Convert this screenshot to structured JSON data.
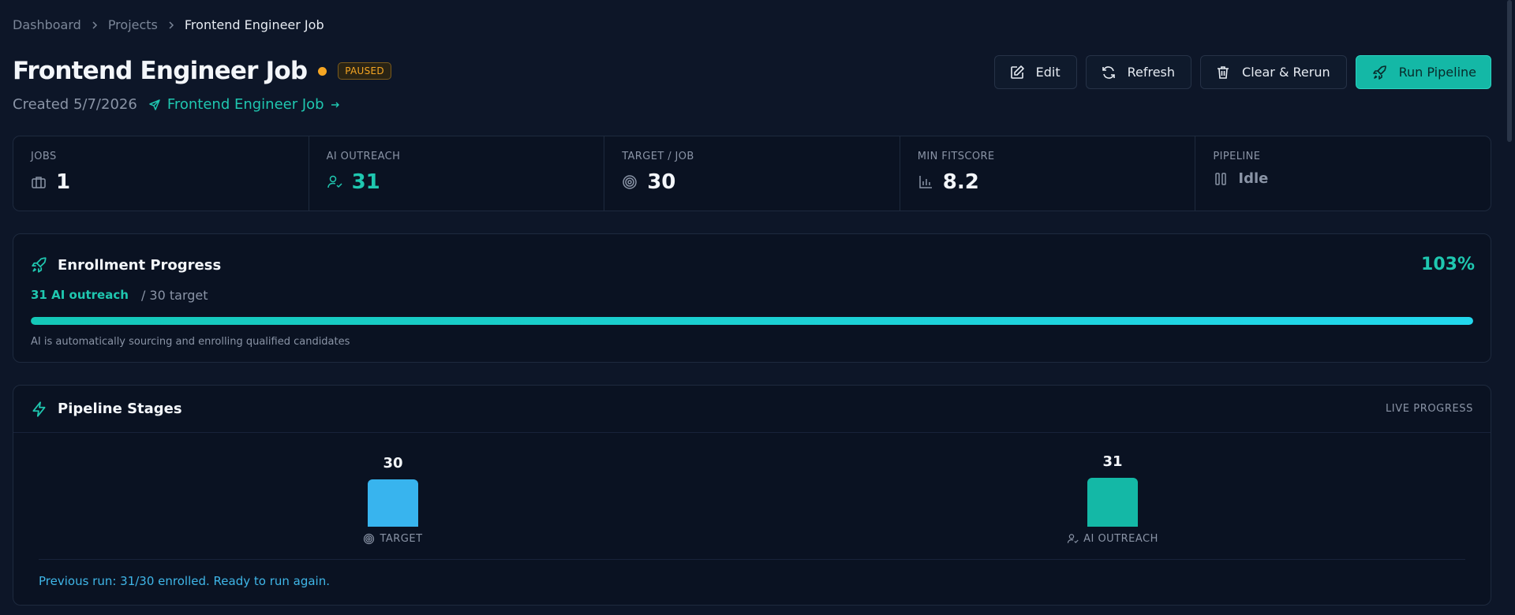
{
  "breadcrumb": [
    "Dashboard",
    "Projects",
    "Frontend Engineer Job"
  ],
  "header": {
    "title": "Frontend Engineer Job",
    "status": "PAUSED",
    "created": "Created 5/7/2026",
    "job_link": "Frontend Engineer Job",
    "actions": {
      "edit": "Edit",
      "refresh": "Refresh",
      "clear_rerun": "Clear & Rerun",
      "run": "Run Pipeline"
    }
  },
  "stats": [
    {
      "label": "JOBS",
      "value": "1",
      "icon": "briefcase-icon"
    },
    {
      "label": "AI OUTREACH",
      "value": "31",
      "icon": "user-check-icon"
    },
    {
      "label": "TARGET / JOB",
      "value": "30",
      "icon": "target-icon"
    },
    {
      "label": "MIN FITSCORE",
      "value": "8.2",
      "icon": "bar-chart-icon"
    },
    {
      "label": "PIPELINE",
      "value": "Idle",
      "icon": "pause-icon"
    }
  ],
  "enrollment": {
    "title": "Enrollment Progress",
    "percent": "103%",
    "outreach": "31 AI outreach",
    "target": "/ 30 target",
    "progress_fraction": 1.0,
    "note": "AI is automatically sourcing and enrolling qualified candidates"
  },
  "pipeline": {
    "title": "Pipeline Stages",
    "live": "LIVE PROGRESS",
    "stages": [
      {
        "label": "TARGET",
        "value": 30,
        "color": "#38b4ee",
        "icon": "target-icon"
      },
      {
        "label": "AI OUTREACH",
        "value": 31,
        "color": "#14b8a6",
        "icon": "user-check-icon"
      }
    ],
    "footer": "Previous run: 31/30 enrolled. Ready to run again."
  },
  "colors": {
    "accent": "#14b8a6",
    "status": "#f6a623",
    "bg": "#0d1628"
  }
}
